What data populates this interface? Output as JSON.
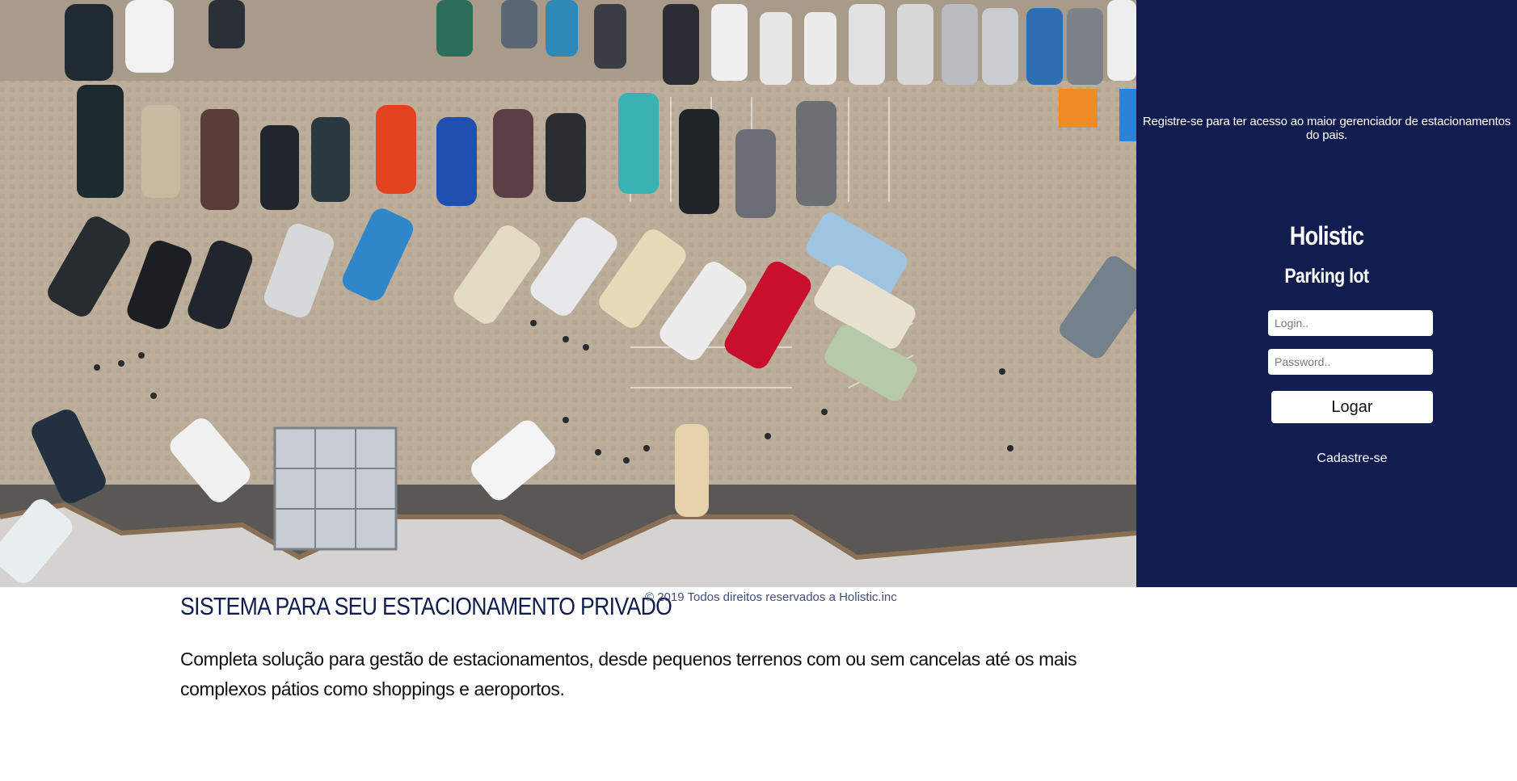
{
  "hero": {
    "image_description_icon": "parking-lot-aerial-photo"
  },
  "panel": {
    "tagline": "Registre-se para ter acesso ao maior gerenciador de estacionamentos do pais.",
    "brand": "Holistic",
    "subbrand": "Parking lot",
    "login_placeholder": "Login..",
    "password_placeholder": "Password..",
    "login_button": "Logar",
    "register_link": "Cadastre-se"
  },
  "footer": {
    "copyright": "© 2019 Todos direitos reservados a Holistic.inc"
  },
  "main": {
    "headline": "SISTEMA PARA SEU ESTACIONAMENTO PRIVADO",
    "description": "Completa solução para gestão de estacionamentos, desde pequenos terrenos com ou sem cancelas até os mais complexos pátios como shoppings e aeroportos."
  },
  "colors": {
    "panel_bg": "#111d4f",
    "headline": "#111d4f",
    "copyright": "#444c7a",
    "pavement": "#b9ab98"
  }
}
